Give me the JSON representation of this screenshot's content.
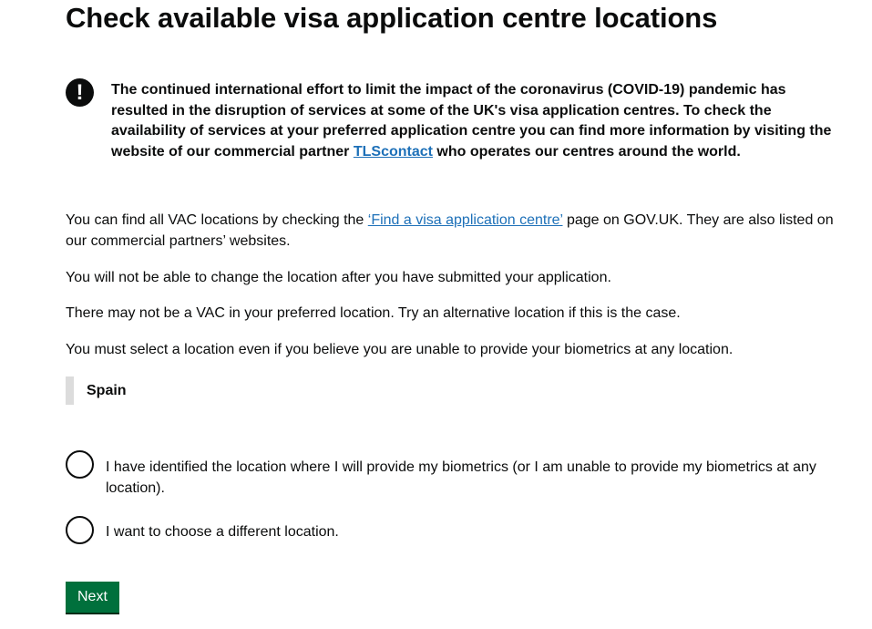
{
  "page": {
    "title": "Check available visa application centre locations"
  },
  "warning": {
    "icon": "exclamation-icon",
    "icon_glyph": "!",
    "text_before_link": "The continued international effort to limit the impact of the coronavirus (COVID-19) pandemic has resulted in the disruption of services at some of the UK's visa application centres. To check the availability of services at your preferred application centre you can find more information by visiting the website of our commercial partner ",
    "link_text": "TLScontact",
    "text_after_link": " who operates our centres around the world."
  },
  "paragraphs": {
    "p1_before_link": "You can find all VAC locations by checking the ",
    "p1_link_text": "‘Find a visa application centre’",
    "p1_after_link": " page on GOV.UK. They are also listed on our commercial partners’ websites.",
    "p2": "You will not be able to change the location after you have submitted your application.",
    "p3": "There may not be a VAC in your preferred location. Try an alternative location if this is the case.",
    "p4": "You must select a location even if you believe you are unable to provide your biometrics at any location."
  },
  "selected_location": {
    "country": "Spain"
  },
  "options": {
    "identified": "I have identified the location where I will provide my biometrics (or I am unable to provide my biometrics at any location).",
    "different": "I want to choose a different location."
  },
  "actions": {
    "next_label": "Next"
  },
  "colors": {
    "text": "#0b0c0c",
    "link": "#1d70b8",
    "button": "#00703c",
    "inset_border": "#dcdcdc"
  }
}
